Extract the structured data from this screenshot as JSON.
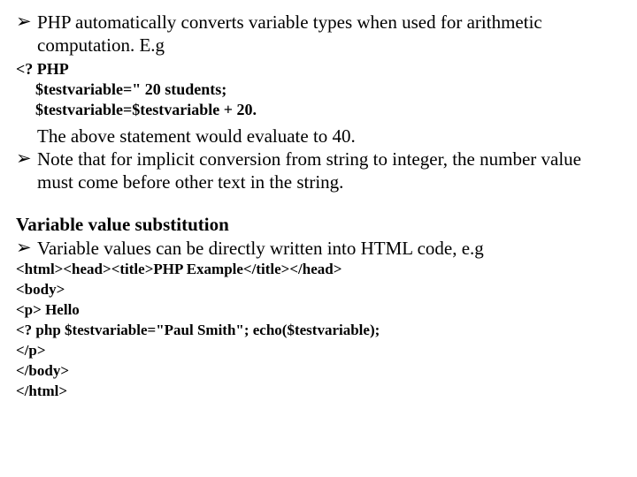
{
  "b1": "PHP automatically converts variable types when used for arithmetic computation. E.g",
  "code1": {
    "l1": "<? PHP",
    "l2": "$testvariable=\" 20 students;",
    "l3": "$testvariable=$testvariable + 20."
  },
  "stmt": "The above statement would evaluate to 40.",
  "b2": "Note that for implicit conversion from string to integer, the number value must come before other text in the string.",
  "heading": "Variable value substitution",
  "b3": "Variable values can be directly written into HTML code, e.g",
  "code2": {
    "l1": "<html><head><title>PHP Example</title></head>",
    "l2": "<body>",
    "l3": "<p> Hello",
    "l4": "<? php $testvariable=\"Paul Smith\"; echo($testvariable);",
    "l5": "</p>",
    "l6": "</body>",
    "l7": "</html>"
  },
  "marks": {
    "tri": "➢"
  }
}
